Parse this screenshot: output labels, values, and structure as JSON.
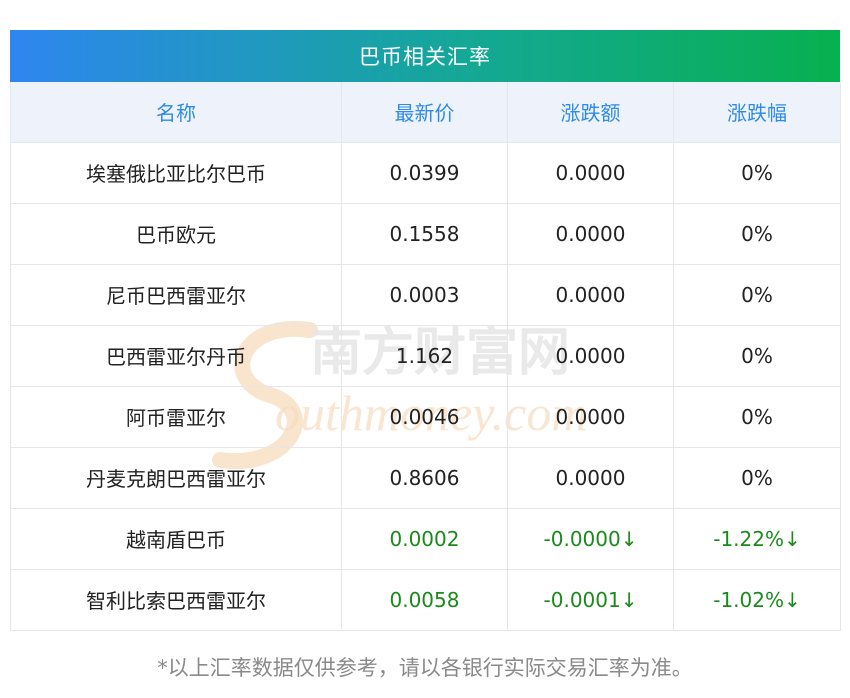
{
  "panel": {
    "title": "巴币相关汇率",
    "columns": [
      "名称",
      "最新价",
      "涨跌额",
      "涨跌幅"
    ]
  },
  "rows": [
    {
      "name": "埃塞俄比亚比尔巴币",
      "price": "0.0399",
      "change": "0.0000",
      "percent": "0%",
      "trend": "flat"
    },
    {
      "name": "巴币欧元",
      "price": "0.1558",
      "change": "0.0000",
      "percent": "0%",
      "trend": "flat"
    },
    {
      "name": "尼币巴西雷亚尔",
      "price": "0.0003",
      "change": "0.0000",
      "percent": "0%",
      "trend": "flat"
    },
    {
      "name": "巴西雷亚尔丹币",
      "price": "1.162",
      "change": "0.0000",
      "percent": "0%",
      "trend": "flat"
    },
    {
      "name": "阿币雷亚尔",
      "price": "0.0046",
      "change": "0.0000",
      "percent": "0%",
      "trend": "flat"
    },
    {
      "name": "丹麦克朗巴西雷亚尔",
      "price": "0.8606",
      "change": "0.0000",
      "percent": "0%",
      "trend": "flat"
    },
    {
      "name": "越南盾巴币",
      "price": "0.0002",
      "change": "-0.0000↓",
      "percent": "-1.22%↓",
      "trend": "down"
    },
    {
      "name": "智利比索巴西雷亚尔",
      "price": "0.0058",
      "change": "-0.0001↓",
      "percent": "-1.02%↓",
      "trend": "down"
    }
  ],
  "footer": {
    "note": "*以上汇率数据仅供参考，请以各银行实际交易汇率为准。"
  },
  "watermark": {
    "cn": "南方财富网",
    "en": "outhmoney.com"
  },
  "colors": {
    "header_gradient_start": "#2e86f0",
    "header_gradient_end": "#08b04f",
    "column_header_text": "#2f8be6",
    "down_text": "#1b8a1b"
  }
}
